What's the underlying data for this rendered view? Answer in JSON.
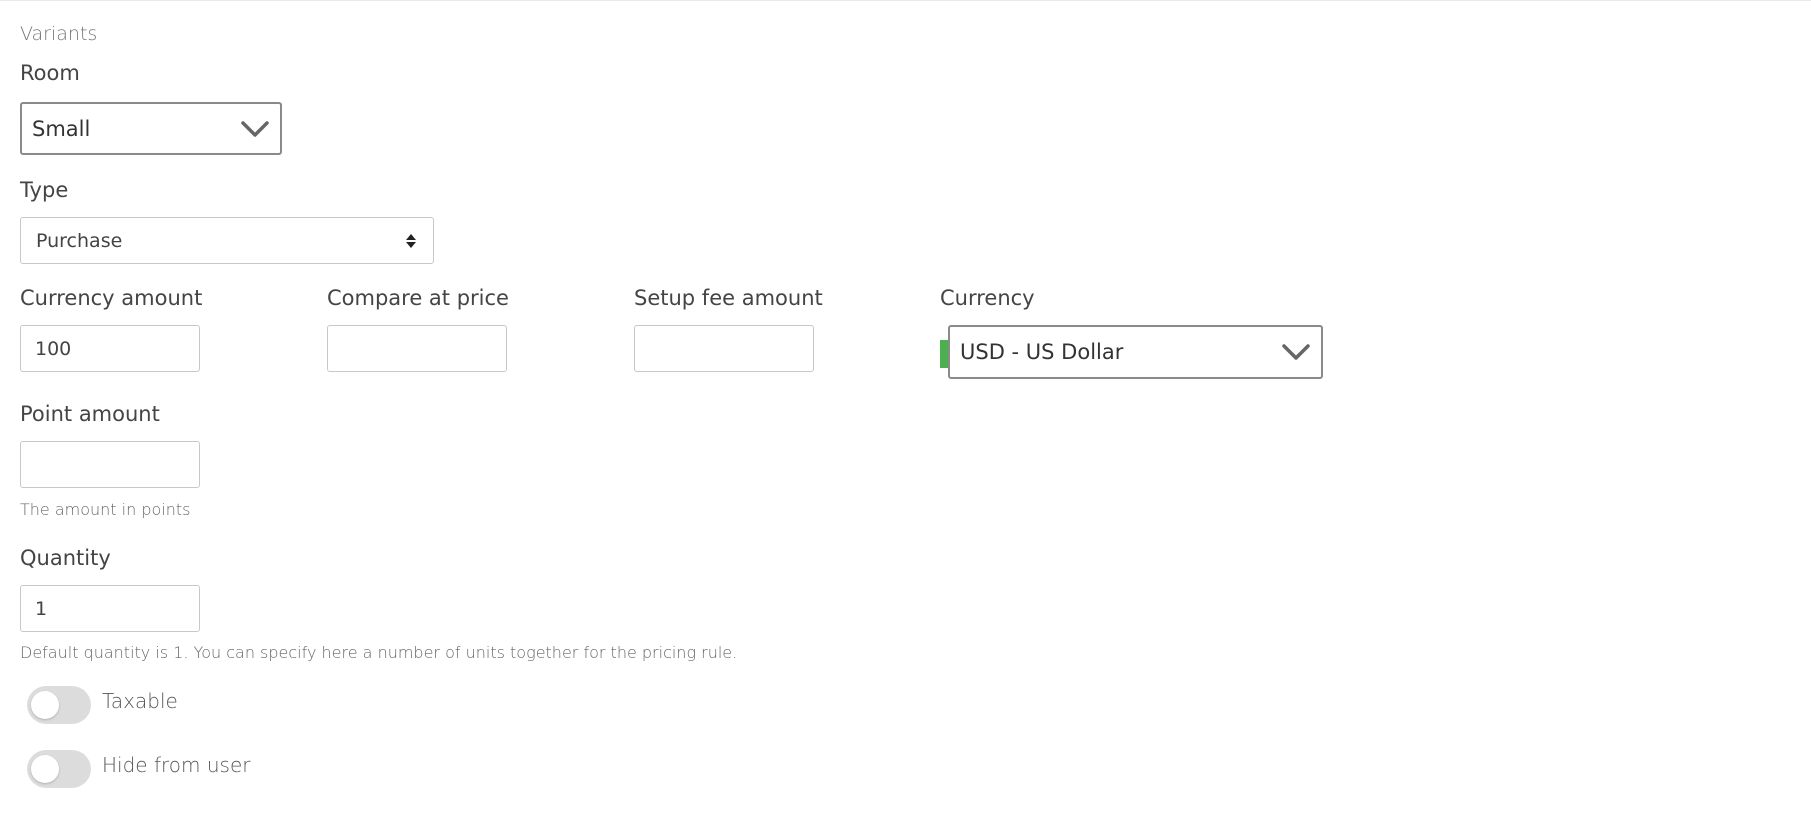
{
  "section": {
    "title": "Variants"
  },
  "room": {
    "label": "Room",
    "value": "Small"
  },
  "type": {
    "label": "Type",
    "value": "Purchase"
  },
  "currency_amount": {
    "label": "Currency amount",
    "value": "100"
  },
  "compare_at_price": {
    "label": "Compare at price",
    "value": ""
  },
  "setup_fee_amount": {
    "label": "Setup fee amount",
    "value": ""
  },
  "currency": {
    "label": "Currency",
    "value": "USD - US Dollar",
    "indicator_color": "#4caf50"
  },
  "point_amount": {
    "label": "Point amount",
    "value": "",
    "help": "The amount in points"
  },
  "quantity": {
    "label": "Quantity",
    "value": "1",
    "help": "Default quantity is 1. You can specify here a number of units together for the pricing rule."
  },
  "toggles": [
    {
      "label": "Taxable",
      "on": false
    },
    {
      "label": "Hide from user",
      "on": false
    }
  ],
  "icons": {
    "select_arrow": "chevron-down-icon",
    "native_select_arrow": "sort-updown-icon"
  }
}
